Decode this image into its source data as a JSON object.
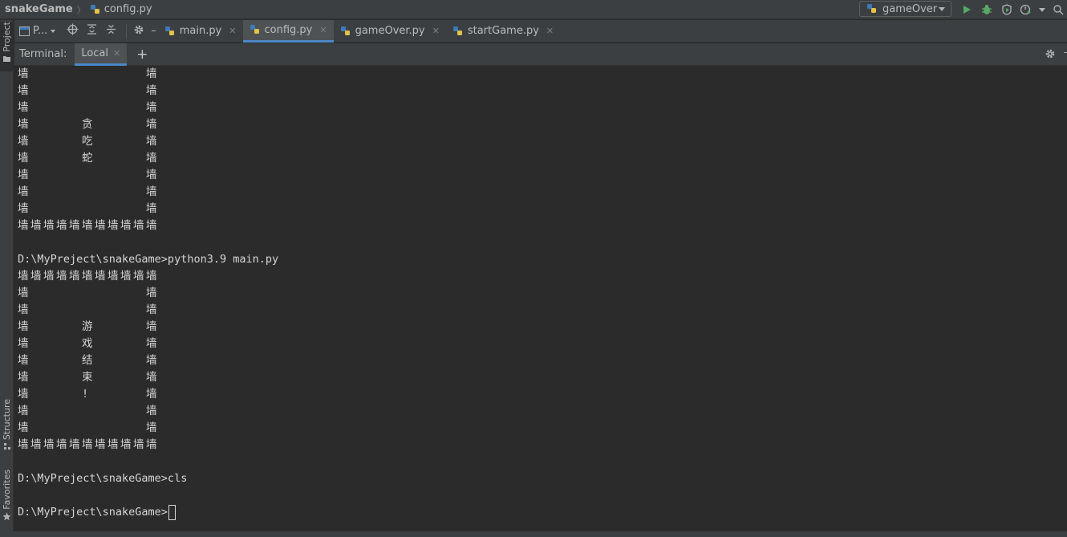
{
  "breadcrumb": {
    "project": "snakeGame",
    "file": "config.py"
  },
  "run_config": {
    "label": "gameOver"
  },
  "toolbar_icons": [
    "run-icon",
    "debug-icon",
    "coverage-icon",
    "more-icon"
  ],
  "left_stripe": {
    "project": "Project",
    "structure": "Structure",
    "favorites": "Favorites"
  },
  "project_tool": {
    "label": "P..."
  },
  "editor_tabs": [
    {
      "label": "main.py",
      "active": false
    },
    {
      "label": "config.py",
      "active": true
    },
    {
      "label": "gameOver.py",
      "active": false
    },
    {
      "label": "startGame.py",
      "active": false
    }
  ],
  "terminal": {
    "title": "Terminal:",
    "tab": "Local",
    "lines": [
      {
        "cells": [
          "墙",
          "",
          "",
          "",
          "",
          "",
          "",
          "",
          "",
          "",
          "墙"
        ]
      },
      {
        "cells": [
          "墙",
          "",
          "",
          "",
          "",
          "",
          "",
          "",
          "",
          "",
          "墙"
        ]
      },
      {
        "cells": [
          "墙",
          "",
          "",
          "",
          "",
          "",
          "",
          "",
          "",
          "",
          "墙"
        ]
      },
      {
        "cells": [
          "墙",
          "",
          "",
          "",
          "",
          "贪",
          "",
          "",
          "",
          "",
          "墙"
        ]
      },
      {
        "cells": [
          "墙",
          "",
          "",
          "",
          "",
          "吃",
          "",
          "",
          "",
          "",
          "墙"
        ]
      },
      {
        "cells": [
          "墙",
          "",
          "",
          "",
          "",
          "蛇",
          "",
          "",
          "",
          "",
          "墙"
        ]
      },
      {
        "cells": [
          "墙",
          "",
          "",
          "",
          "",
          "",
          "",
          "",
          "",
          "",
          "墙"
        ]
      },
      {
        "cells": [
          "墙",
          "",
          "",
          "",
          "",
          "",
          "",
          "",
          "",
          "",
          "墙"
        ]
      },
      {
        "cells": [
          "墙",
          "",
          "",
          "",
          "",
          "",
          "",
          "",
          "",
          "",
          "墙"
        ]
      },
      {
        "cells": [
          "墙",
          "墙",
          "墙",
          "墙",
          "墙",
          "墙",
          "墙",
          "墙",
          "墙",
          "墙",
          "墙"
        ]
      },
      {
        "text": ""
      },
      {
        "text": "D:\\MyPreject\\snakeGame>python3.9 main.py"
      },
      {
        "cells": [
          "墙",
          "墙",
          "墙",
          "墙",
          "墙",
          "墙",
          "墙",
          "墙",
          "墙",
          "墙",
          "墙"
        ]
      },
      {
        "cells": [
          "墙",
          "",
          "",
          "",
          "",
          "",
          "",
          "",
          "",
          "",
          "墙"
        ]
      },
      {
        "cells": [
          "墙",
          "",
          "",
          "",
          "",
          "",
          "",
          "",
          "",
          "",
          "墙"
        ]
      },
      {
        "cells": [
          "墙",
          "",
          "",
          "",
          "",
          "游",
          "",
          "",
          "",
          "",
          "墙"
        ]
      },
      {
        "cells": [
          "墙",
          "",
          "",
          "",
          "",
          "戏",
          "",
          "",
          "",
          "",
          "墙"
        ]
      },
      {
        "cells": [
          "墙",
          "",
          "",
          "",
          "",
          "结",
          "",
          "",
          "",
          "",
          "墙"
        ]
      },
      {
        "cells": [
          "墙",
          "",
          "",
          "",
          "",
          "束",
          "",
          "",
          "",
          "",
          "墙"
        ]
      },
      {
        "cells": [
          "墙",
          "",
          "",
          "",
          "",
          "!",
          "",
          "",
          "",
          "",
          "墙"
        ]
      },
      {
        "cells": [
          "墙",
          "",
          "",
          "",
          "",
          "",
          "",
          "",
          "",
          "",
          "墙"
        ]
      },
      {
        "cells": [
          "墙",
          "",
          "",
          "",
          "",
          "",
          "",
          "",
          "",
          "",
          "墙"
        ]
      },
      {
        "cells": [
          "墙",
          "墙",
          "墙",
          "墙",
          "墙",
          "墙",
          "墙",
          "墙",
          "墙",
          "墙",
          "墙"
        ]
      },
      {
        "text": ""
      },
      {
        "text": "D:\\MyPreject\\snakeGame>cls"
      },
      {
        "text": ""
      },
      {
        "text": "D:\\MyPreject\\snakeGame>",
        "cursor": true
      }
    ]
  },
  "colors": {
    "accent": "#4a88c7",
    "run": "#59a869",
    "debug": "#59a869"
  }
}
